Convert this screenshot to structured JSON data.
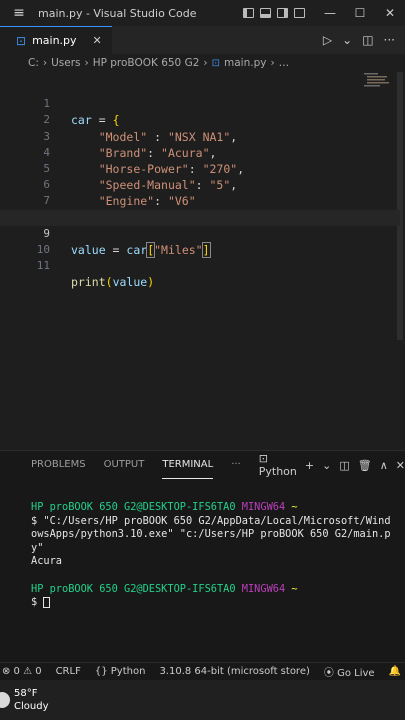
{
  "titlebar": {
    "menu_icon": "≡",
    "title": "main.py - Visual Studio Code"
  },
  "window_controls": {
    "minimize": "—",
    "maximize": "☐",
    "close": "✕"
  },
  "tab": {
    "file_icon": "⊡",
    "name": "main.py",
    "close": "✕"
  },
  "editor_actions": {
    "run": "▷",
    "run_menu": "⌄",
    "split": "◫",
    "more": "···"
  },
  "breadcrumb": [
    "C:",
    "Users",
    "HP  proBOOK 650 G2",
    "main.py",
    "…"
  ],
  "code_lines": [
    {
      "n": "1"
    },
    {
      "n": "2"
    },
    {
      "n": "3"
    },
    {
      "n": "4"
    },
    {
      "n": "5"
    },
    {
      "n": "6"
    },
    {
      "n": "7"
    },
    {
      "n": "8"
    },
    {
      "n": "9"
    },
    {
      "n": "10"
    },
    {
      "n": "11"
    }
  ],
  "code": {
    "l1_var": "car",
    "l1_op": " = ",
    "l1_brace": "{",
    "l2_key": "\"Model\"",
    "l2_sep": " : ",
    "l2_val": "\"NSX NA1\"",
    "l2_end": ",",
    "l3_key": "\"Brand\"",
    "l3_sep": ": ",
    "l3_val": "\"Acura\"",
    "l3_end": ",",
    "l4_key": "\"Horse-Power\"",
    "l4_sep": ": ",
    "l4_val": "\"270\"",
    "l4_end": ",",
    "l5_key": "\"Speed-Manual\"",
    "l5_sep": ": ",
    "l5_val": "\"5\"",
    "l5_end": ",",
    "l6_key": "\"Engine\"",
    "l6_sep": ": ",
    "l6_val": "\"V6\"",
    "l7_brace": "}",
    "l9_var": "value",
    "l9_op": " = ",
    "l9_obj": "car",
    "l9_open": "[",
    "l9_key": "\"Miles\"",
    "l9_close": "]",
    "l11_fn": "print",
    "l11_open": "(",
    "l11_arg": "value",
    "l11_close": ")"
  },
  "panel": {
    "tabs": [
      "PROBLEMS",
      "OUTPUT",
      "TERMINAL",
      "···"
    ],
    "shell": "Python",
    "actions": {
      "add": "+",
      "add_menu": "⌄",
      "split": "◫",
      "trash": "🗑",
      "max": "∧",
      "close": "✕"
    }
  },
  "terminal": {
    "prompt_user": "HP  proBOOK 650 G2@DESKTOP-IFS6TA0",
    "prompt_env": "MINGW64",
    "prompt_dir": "~",
    "command_1": "$ \"C:/Users/HP  proBOOK 650 G2/AppData/Local/Microsoft/Wind",
    "command_2": "owsApps/python3.10.exe\" \"c:/Users/HP  proBOOK 650 G2/main.p",
    "command_3": "y\"",
    "output": "Acura",
    "prompt2_user": "HP  proBOOK 650 G2@DESKTOP-IFS6TA0",
    "prompt2_env": "MINGW64",
    "prompt2_dir": "~",
    "input_prompt": "$ "
  },
  "statusbar": {
    "problems": "⊗ 0  ⚠ 0",
    "eol": "CRLF",
    "language": "Python",
    "interpreter": "3.10.8 64-bit (microsoft store)",
    "golive": "Go Live",
    "bell": "🔔"
  },
  "taskbar": {
    "temp": "58°F",
    "condition": "Cloudy"
  }
}
